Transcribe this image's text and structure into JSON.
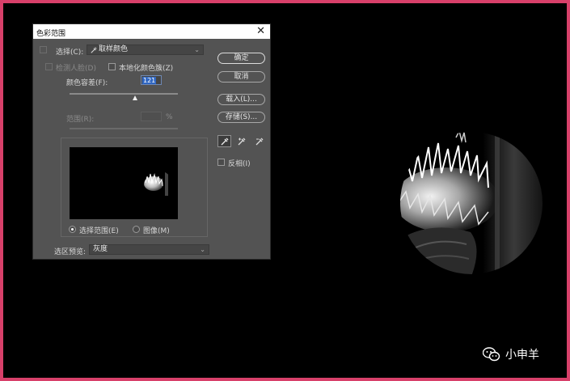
{
  "dialog": {
    "title": "色彩范围",
    "select": {
      "label": "选择(C):",
      "value": "取样颜色"
    },
    "detect_faces": "检测人脸(D)",
    "localized_clusters": "本地化颜色簇(Z)",
    "fuzziness": {
      "label": "颜色容差(F):",
      "value": "121"
    },
    "range": {
      "label": "范围(R):",
      "unit": "%"
    },
    "view_options": {
      "selection": "选择范围(E)",
      "image": "图像(M)",
      "selected": "selection"
    },
    "preview_mode": {
      "label": "选区预览:",
      "value": "灰度"
    },
    "buttons": {
      "ok": "确定",
      "cancel": "取消",
      "load": "载入(L)...",
      "save": "存储(S)..."
    },
    "invert": "反相(I)"
  },
  "watermark": {
    "text": "小申羊"
  },
  "colors": {
    "border": "#d8406a",
    "dialog_bg": "#535353",
    "highlight": "#2f66c2"
  },
  "icons": [
    "close-icon",
    "eyedropper-icon",
    "eyedropper-add-icon",
    "eyedropper-subtract-icon",
    "chevron-down-icon",
    "wechat-icon"
  ]
}
